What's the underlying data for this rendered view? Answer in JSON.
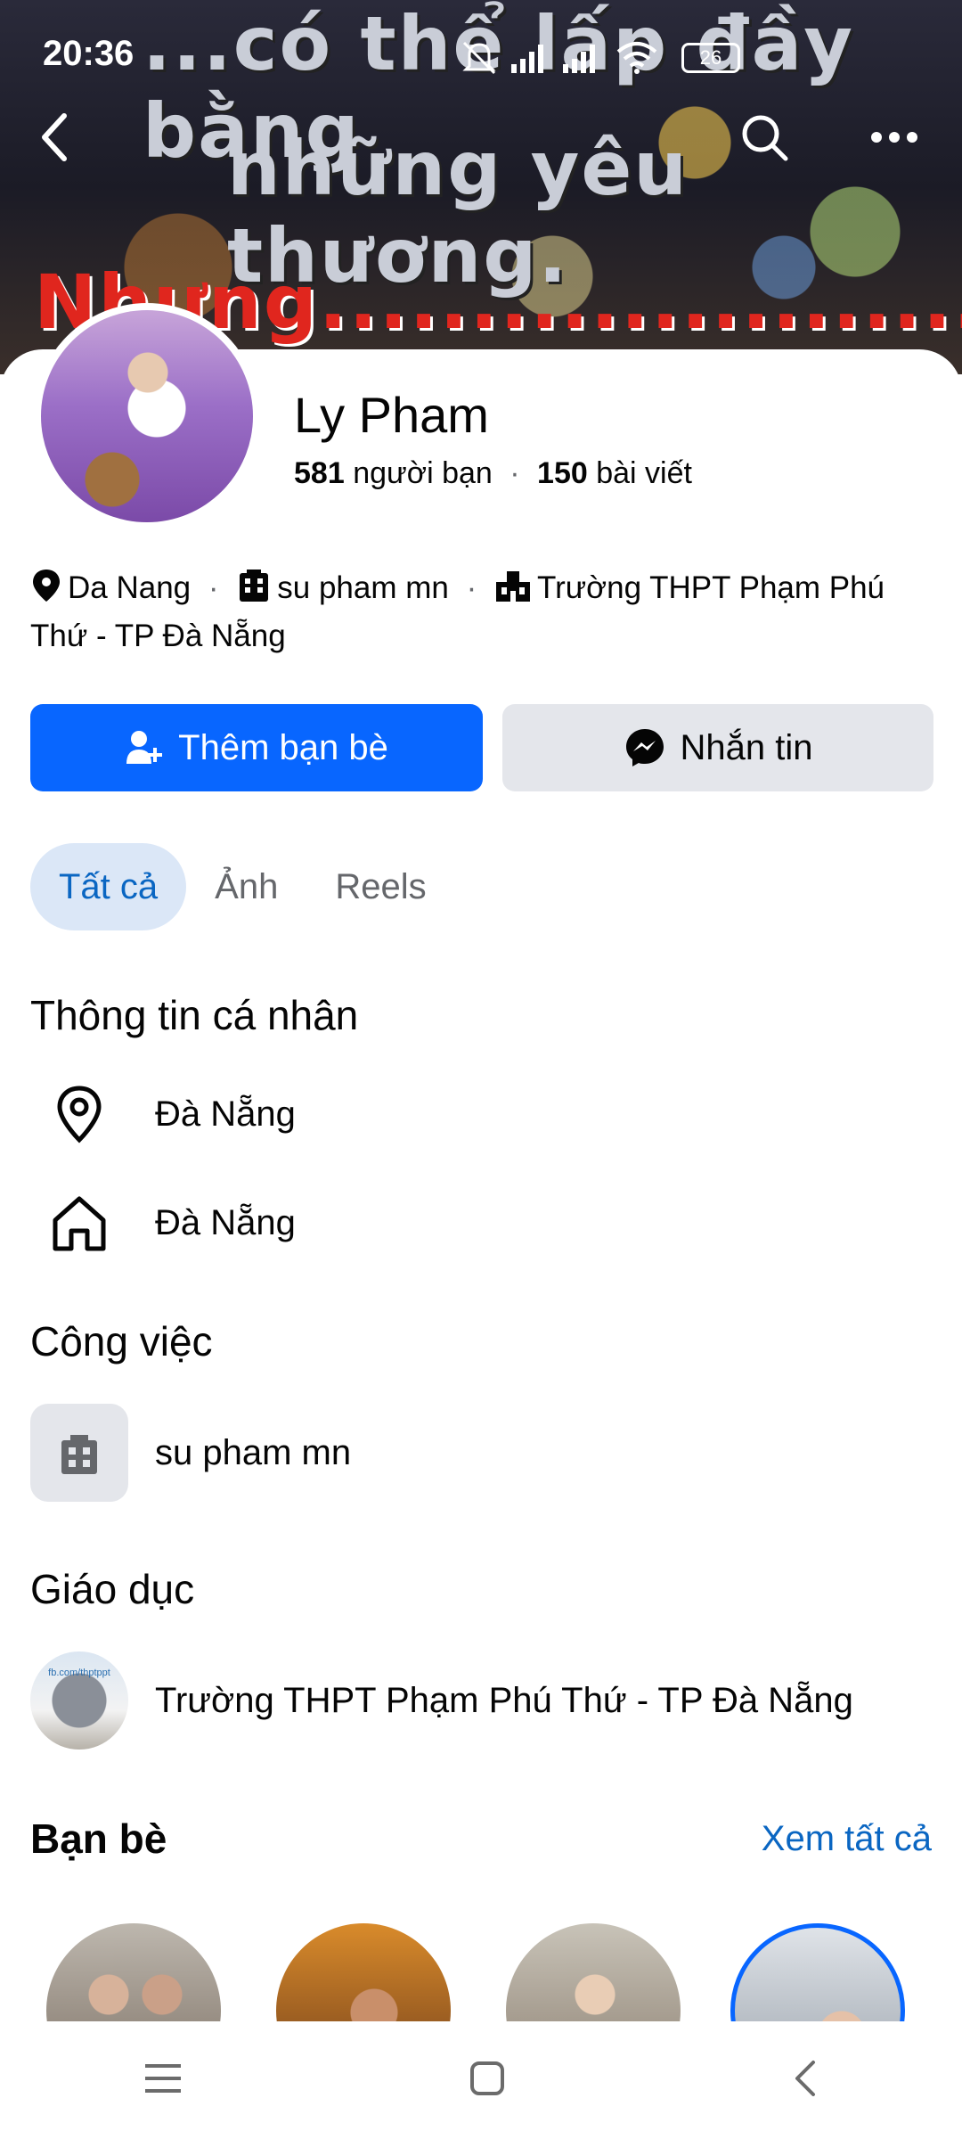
{
  "status_bar": {
    "time": "20:36",
    "battery": "26"
  },
  "cover": {
    "line1": "...có thể lấp đầy bằng",
    "line2": "những yêu thương.",
    "line3": "Nhưng............................"
  },
  "profile": {
    "name": "Ly Pham",
    "friends_count": "581",
    "friends_label": "người bạn",
    "posts_count": "150",
    "posts_label": "bài viết",
    "location": "Da Nang",
    "work": "su pham mn",
    "school": "Trường THPT Phạm Phú Thứ - TP Đà Nẵng"
  },
  "actions": {
    "add_friend": "Thêm bạn bè",
    "message": "Nhắn tin"
  },
  "tabs": [
    {
      "label": "Tất cả"
    },
    {
      "label": "Ảnh"
    },
    {
      "label": "Reels"
    }
  ],
  "personal_info": {
    "title": "Thông tin cá nhân",
    "current_city": "Đà Nẵng",
    "hometown": "Đà Nẵng"
  },
  "work_section": {
    "title": "Công việc",
    "item": "su pham mn"
  },
  "education_section": {
    "title": "Giáo dục",
    "item": "Trường THPT Phạm Phú Thứ - TP Đà Nẵng",
    "thumb_text": "fb.com/thptppt"
  },
  "friends_section": {
    "title": "Bạn bè",
    "see_all": "Xem tất cả"
  },
  "colors": {
    "primary": "#0866ff",
    "link": "#0a66c2",
    "tab_active_bg": "#dbe7f7",
    "secondary_btn": "#e4e6eb"
  }
}
